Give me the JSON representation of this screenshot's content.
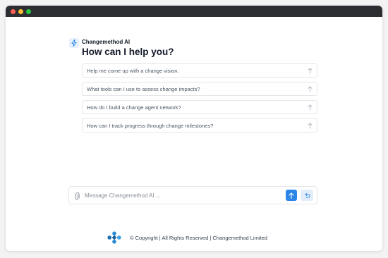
{
  "brand": {
    "name": "Changemethod AI"
  },
  "heading": "How can I help you?",
  "suggestions": [
    {
      "label": "Help me come up with a change vision."
    },
    {
      "label": "What tools can I use to assess change impacts?"
    },
    {
      "label": "How do I build a change agent network?"
    },
    {
      "label": "How can I track progress through change milestones?"
    }
  ],
  "composer": {
    "placeholder": "Message Changemethod AI ...",
    "value": ""
  },
  "footer": {
    "text": "© Copyright  | All Rights Reserved | Changemethod Limited"
  },
  "icons": {
    "brand": "lightning-icon",
    "suggestion": "arrow-up-icon",
    "attach": "paperclip-icon",
    "send": "send-arrow-icon",
    "undo": "undo-icon",
    "logo": "changemethod-logo"
  },
  "colors": {
    "accent": "#2b86e8",
    "accent_light": "#e2edf9",
    "logo": "#2a8bd4"
  }
}
